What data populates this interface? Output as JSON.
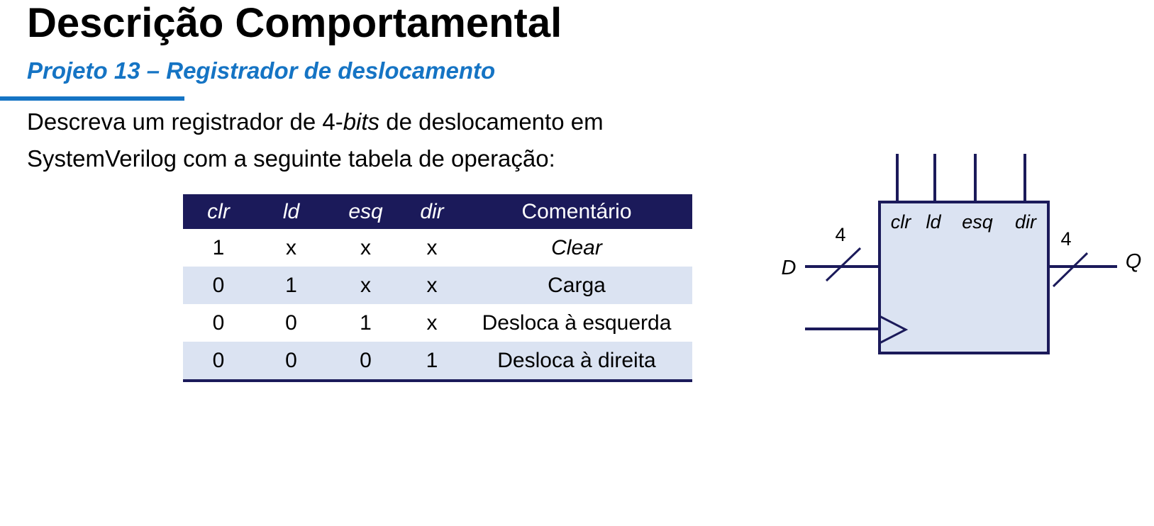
{
  "slide": {
    "title": "Descrição Comportamental",
    "subtitle": "Projeto 13 – Registrador de deslocamento",
    "description": {
      "part1": "Descreva um registrador de 4-",
      "italic": "bits",
      "part2": " de deslocamento em",
      "line2": "SystemVerilog com a seguinte tabela de operação:"
    }
  },
  "table": {
    "headers": [
      "clr",
      "ld",
      "esq",
      "dir",
      "Comentário"
    ],
    "rows": [
      [
        "1",
        "x",
        "x",
        "x",
        "Clear"
      ],
      [
        "0",
        "1",
        "x",
        "x",
        "Carga"
      ],
      [
        "0",
        "0",
        "1",
        "x",
        "Desloca à esquerda"
      ],
      [
        "0",
        "0",
        "0",
        "1",
        "Desloca à direita"
      ]
    ]
  },
  "diagram": {
    "inputs": [
      "clr",
      "ld",
      "esq",
      "dir"
    ],
    "data_in_label": "D",
    "data_in_width": "4",
    "data_out_label": "Q",
    "data_out_width": "4"
  },
  "colors": {
    "accent_blue": "#1574c4",
    "header_navy": "#1b1a5a",
    "row_shade": "#dbe3f2",
    "block_fill": "#dbe3f2",
    "wire": "#1b1a5a"
  }
}
